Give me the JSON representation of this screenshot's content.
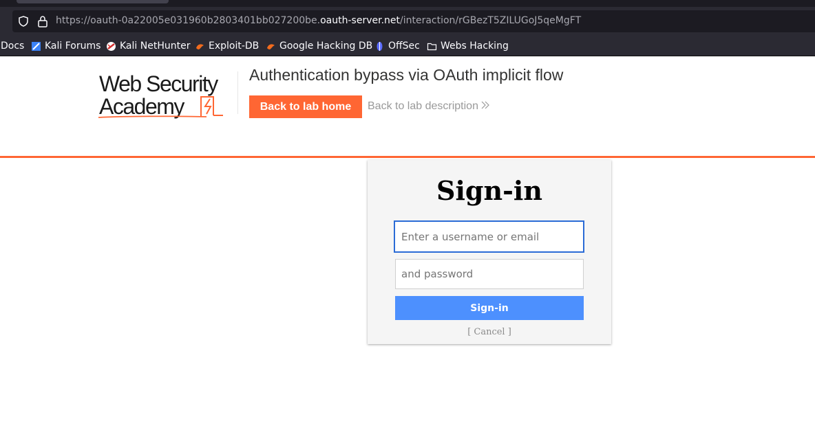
{
  "browser": {
    "url_prefix": "https://oauth-0a22005e031960b2803401bb027200be.",
    "url_host": "oauth-server.net",
    "url_path": "/interaction/rGBezT5ZILUGoJ5qeMgFT",
    "bookmarks": [
      {
        "label": "Docs",
        "icon": "none"
      },
      {
        "label": "Kali Forums",
        "icon": "kali-forums-icon"
      },
      {
        "label": "Kali NetHunter",
        "icon": "kali-nethunter-icon"
      },
      {
        "label": "Exploit-DB",
        "icon": "exploit-db-icon"
      },
      {
        "label": "Google Hacking DB",
        "icon": "ghdb-icon"
      },
      {
        "label": "OffSec",
        "icon": "offsec-icon"
      },
      {
        "label": "Webs Hacking",
        "icon": "folder-icon"
      }
    ]
  },
  "lab": {
    "logo_line1": "Web Security",
    "logo_line2": "Academy",
    "title": "Authentication bypass via OAuth implicit flow",
    "back_home_label": "Back to lab home",
    "back_desc_label": "Back to lab description"
  },
  "signin": {
    "title": "Sign-in",
    "username_placeholder": "Enter a username or email",
    "password_placeholder": "and password",
    "button_label": "Sign-in",
    "cancel_label": "[ Cancel ]"
  },
  "colors": {
    "accent": "#ff6633",
    "button_blue": "#4d90fe",
    "focus_blue": "#2a6bd6"
  }
}
